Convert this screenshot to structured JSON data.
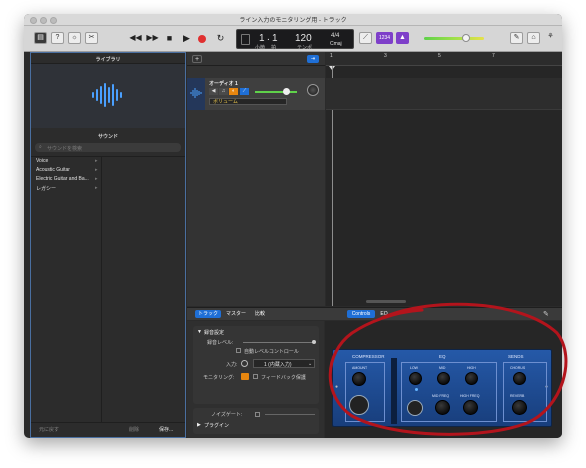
{
  "window": {
    "title": "ライン入力のモニタリング用 - トラック"
  },
  "toolbar": {
    "lcd": {
      "bar": "1",
      "beat": "1",
      "bar_label": "小節",
      "beat_label": "拍",
      "tempo": "120",
      "tempo_label": "テンポ",
      "sig_top": "4/4",
      "sig_key": "Cmaj"
    },
    "count_in": "1234",
    "transport_icons": [
      "rewind-icon",
      "fast-forward-icon",
      "stop-icon",
      "play-icon",
      "record-icon",
      "cycle-icon"
    ]
  },
  "library": {
    "header": "ライブラリ",
    "sound_header": "サウンド",
    "search_placeholder": "サウンドを検索",
    "items": [
      "Voice",
      "Acoustic Guitar",
      "Electric Guitar and Ba...",
      "レガシー"
    ],
    "revert_button": "元に戻す",
    "delete_button": "削除",
    "save_button": "保存..."
  },
  "track": {
    "name": "オーディオ 1",
    "automation": "ボリューム"
  },
  "ruler": {
    "numbers": [
      "1",
      "3",
      "5",
      "7"
    ]
  },
  "smart_controls": {
    "tabs": [
      "トラック",
      "マスター",
      "比較"
    ],
    "right_tabs": [
      "Controls",
      "EQ"
    ],
    "recording_section": "録音設定",
    "record_level": "録音レベル:",
    "auto_level": "自動レベルコントロール",
    "input_label": "入力:",
    "input_value": "1 (内蔵入力)",
    "monitoring_label": "モニタリング:",
    "feedback": "フィードバック保護",
    "noise_gate": "ノイズゲート:",
    "plugins": "プラグイン",
    "compressor": "COMPRESSOR",
    "eq": "EQ",
    "sends": "SENDS",
    "knob_labels": [
      "AMOUNT",
      "LOW",
      "MID",
      "HIGH",
      "MID FREQ",
      "HIGH FREQ",
      "CHORUS",
      "REVERB"
    ]
  },
  "colors": {
    "accent": "#1f6fd6",
    "panel_blue": "#1f4f9a",
    "record": "#e03030",
    "annotation": "#b3141c",
    "level": "#5fd14a"
  }
}
